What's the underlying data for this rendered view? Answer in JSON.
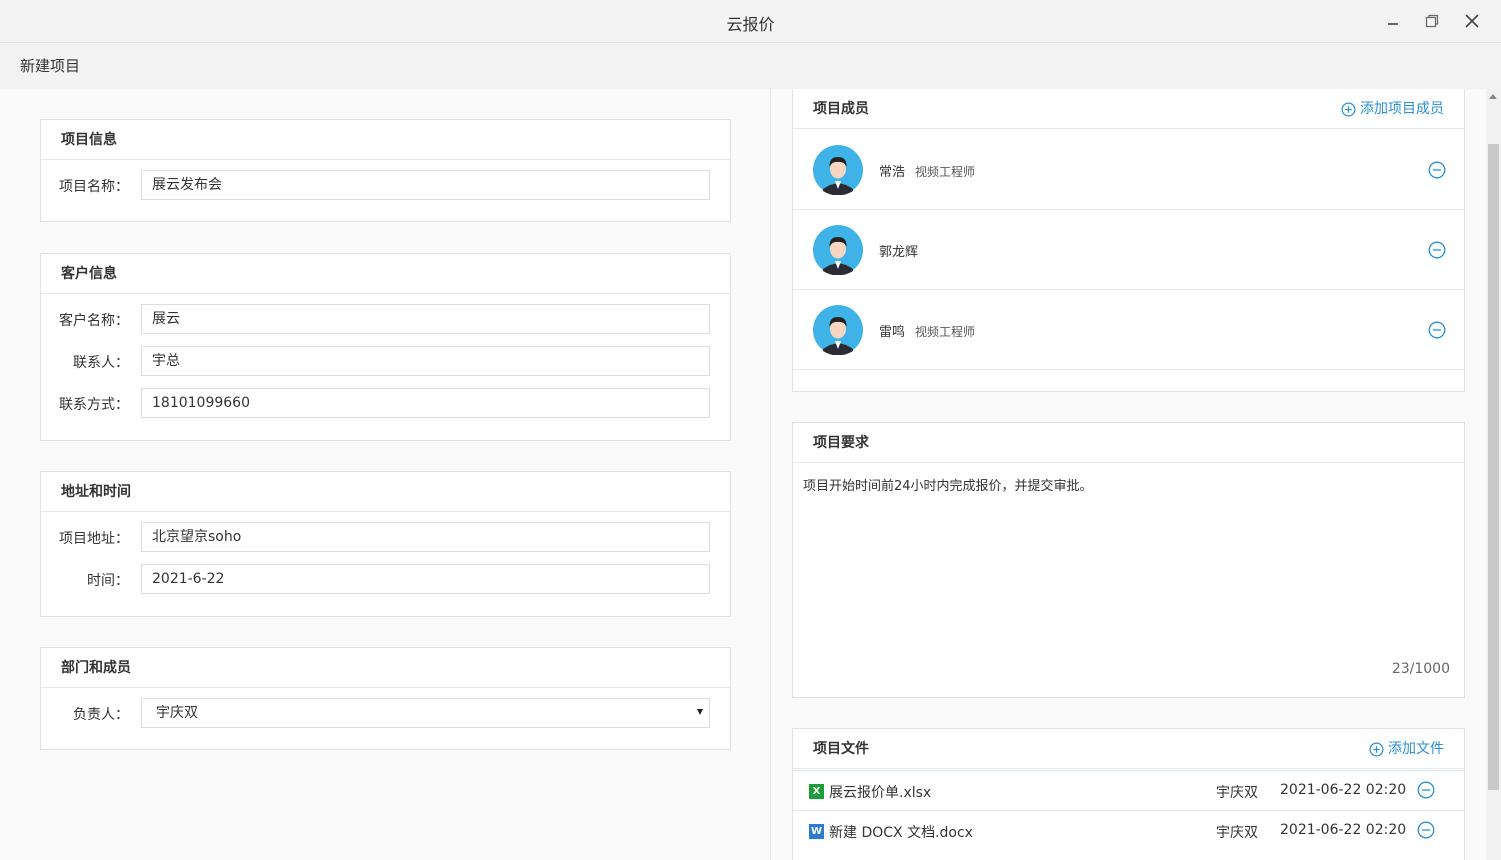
{
  "window": {
    "title": "云报价"
  },
  "subbar": {
    "label": "新建项目"
  },
  "project_info": {
    "header": "项目信息",
    "name_label": "项目名称：",
    "name_value": "展云发布会"
  },
  "customer_info": {
    "header": "客户信息",
    "customer_label": "客户名称：",
    "customer_value": "展云",
    "contact_label": "联系人：",
    "contact_value": "宇总",
    "phone_label": "联系方式：",
    "phone_value": "18101099660"
  },
  "address_time": {
    "header": "地址和时间",
    "address_label": "项目地址：",
    "address_value": "北京望京soho",
    "time_label": "时间：",
    "time_value": "2021-6-22"
  },
  "department": {
    "header": "部门和成员",
    "owner_label": "负责人：",
    "owner_value": "宇庆双"
  },
  "members": {
    "header": "项目成员",
    "add_label": "添加项目成员",
    "items": [
      {
        "name": "常浩",
        "role": "视频工程师"
      },
      {
        "name": "郭龙辉",
        "role": ""
      },
      {
        "name": "雷鸣",
        "role": "视频工程师"
      }
    ]
  },
  "requirements": {
    "header": "项目要求",
    "text": "项目开始时间前24小时内完成报价，并提交审批。",
    "count": "23/1000"
  },
  "files": {
    "header": "项目文件",
    "add_label": "添加文件",
    "items": [
      {
        "name": "展云报价单.xlsx",
        "icon": "excel-icon",
        "owner": "宇庆双",
        "time": "2021-06-22 02:20"
      },
      {
        "name": "新建 DOCX 文档.docx",
        "icon": "word-icon",
        "owner": "宇庆双",
        "time": "2021-06-22 02:20"
      }
    ]
  },
  "colors": {
    "accent": "#2a8fd6",
    "avatar_bg": "#3fb2e8",
    "excel": "#1e9e3a",
    "word": "#2b7bd1"
  }
}
